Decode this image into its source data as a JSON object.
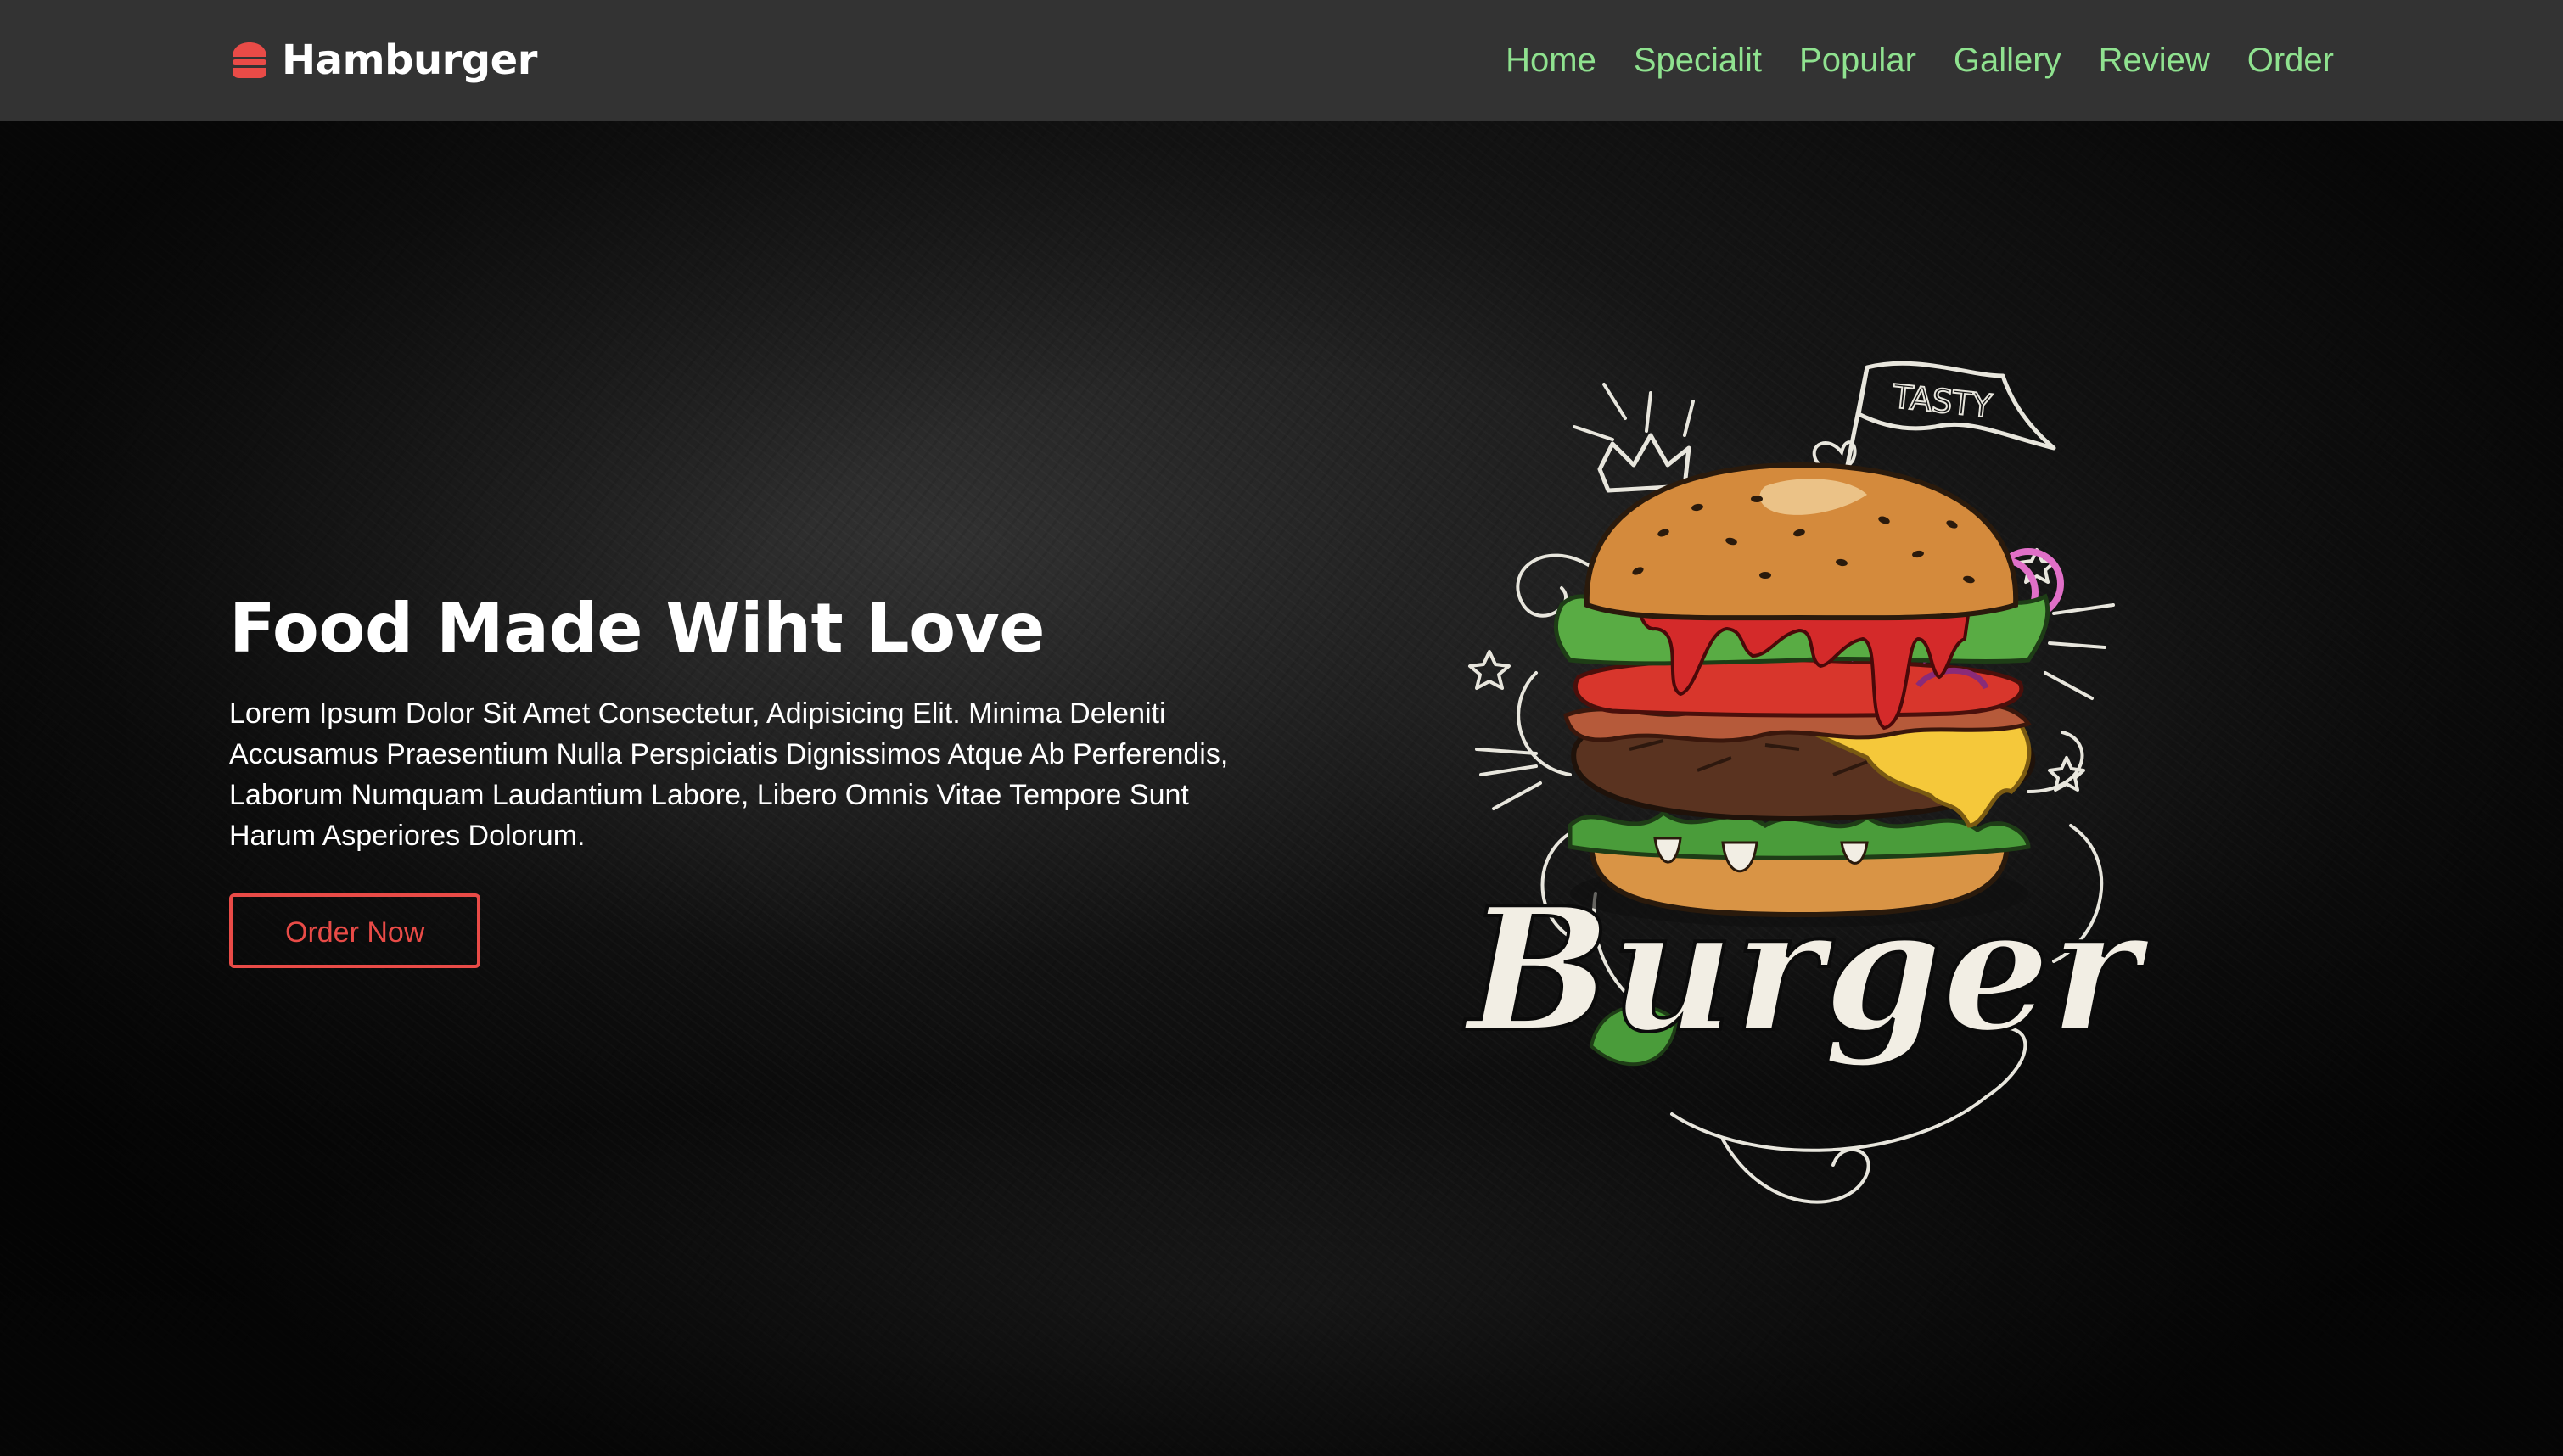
{
  "brand": {
    "name": "Hamburger",
    "icon": "hamburger-icon",
    "icon_color": "#e94b47"
  },
  "nav": {
    "items": [
      {
        "label": "Home"
      },
      {
        "label": "Specialit"
      },
      {
        "label": "Popular"
      },
      {
        "label": "Gallery"
      },
      {
        "label": "Review"
      },
      {
        "label": "Order"
      }
    ],
    "link_color": "#8fe28f"
  },
  "hero": {
    "title": "Food Made Wiht Love",
    "description": "Lorem Ipsum Dolor Sit Amet Consectetur, Adipisicing Elit. Minima Deleniti Accusamus Praesentium Nulla Perspiciatis Dignissimos Atque Ab Perferendis, Laborum Numquam Laudantium Labore, Libero Omnis Vitae Tempore Sunt Harum Asperiores Dolorum.",
    "button_label": "Order Now",
    "button_color": "#e94b47",
    "artwork": {
      "flag_text": "TASTY",
      "script_text": "Burger"
    }
  },
  "colors": {
    "navbar_bg": "#333333",
    "hero_bg": "#141414",
    "text": "#ffffff"
  }
}
